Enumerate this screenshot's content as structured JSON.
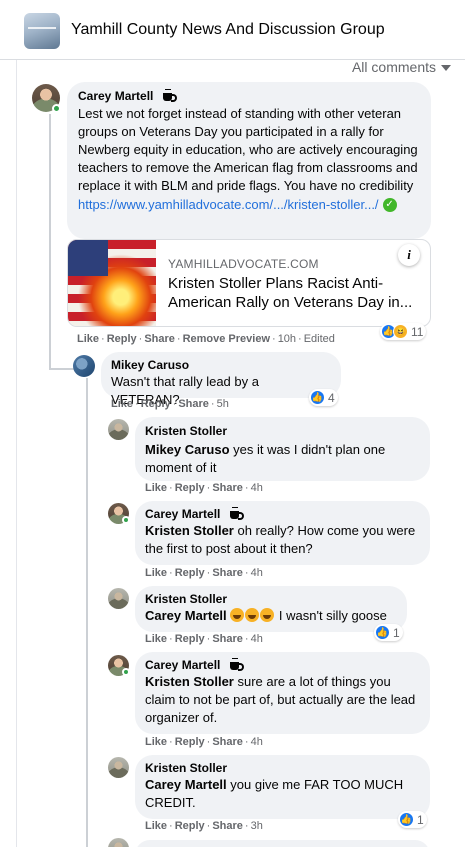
{
  "group": {
    "title": "Yamhill County News And Discussion Group"
  },
  "sort": {
    "label": "All comments"
  },
  "comments": [
    {
      "author": "Carey Martell",
      "text": "Lest we not forget instead of standing with other veteran groups on Veterans Day you participated in a rally for Newberg equity in education, who are actively encouraging teachers to remove the American flag from classrooms and replace it with BLM and pride flags. You have no credibility",
      "link": "https://www.yamhilladvocate.com/.../kristen-stoller.../",
      "preview": {
        "domain": "YAMHILLADVOCATE.COM",
        "title": "Kristen Stoller Plans Racist Anti-American Rally on Veterans Day in..."
      },
      "actions": {
        "like": "Like",
        "reply": "Reply",
        "share": "Share",
        "remove": "Remove Preview",
        "time": "10h",
        "edited": "Edited"
      },
      "reaction_count": "11"
    },
    {
      "author": "Mikey Caruso",
      "text": "Wasn't that rally lead by a VETERAN?",
      "actions": {
        "like": "Like",
        "reply": "Reply",
        "share": "Share",
        "time": "5h"
      },
      "reaction_count": "4"
    },
    {
      "author": "Kristen Stoller",
      "mention": "Mikey Caruso",
      "text": " yes it was I didn't plan one moment of it",
      "actions": {
        "like": "Like",
        "reply": "Reply",
        "share": "Share",
        "time": "4h"
      }
    },
    {
      "author": "Carey Martell",
      "mention": "Kristen Stoller",
      "text": " oh really? How come you were the first to post about it then?",
      "actions": {
        "like": "Like",
        "reply": "Reply",
        "share": "Share",
        "time": "4h"
      }
    },
    {
      "author": "Kristen Stoller",
      "mention": "Carey Martell",
      "text": " I wasn't silly goose",
      "actions": {
        "like": "Like",
        "reply": "Reply",
        "share": "Share",
        "time": "4h"
      },
      "reaction_count": "1"
    },
    {
      "author": "Carey Martell",
      "mention": "Kristen Stoller",
      "text": " sure are a lot of things you claim to not be part of, but actually are the lead organizer of.",
      "actions": {
        "like": "Like",
        "reply": "Reply",
        "share": "Share",
        "time": "4h"
      }
    },
    {
      "author": "Kristen Stoller",
      "mention": "Carey Martell",
      "text": " you give me FAR TOO MUCH CREDIT.",
      "actions": {
        "like": "Like",
        "reply": "Reply",
        "share": "Share",
        "time": "3h"
      },
      "reaction_count": "1"
    }
  ],
  "colors": {
    "accent": "#1877f2",
    "link": "#216fdb",
    "bubble": "#f0f2f5",
    "online": "#31a24c"
  }
}
